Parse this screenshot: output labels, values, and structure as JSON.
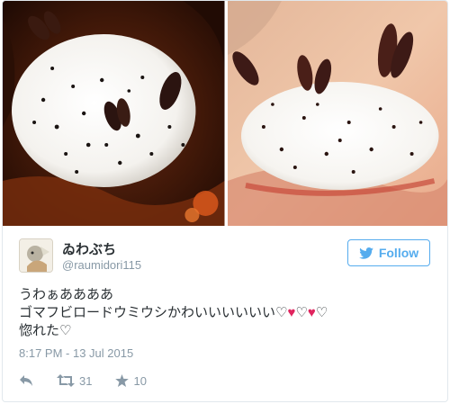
{
  "tweet": {
    "display_name": "ゐわぶち",
    "handle": "@raumidori115",
    "follow_label": "Follow",
    "text_lines": [
      "うわぁああああ",
      "ゴマフビロードウミウシかわいいいいいい",
      "惚れた♡"
    ],
    "hearts": [
      "♡",
      "♥",
      "♡",
      "♥",
      "♡"
    ],
    "timestamp": "8:17 PM - 13 Jul 2015",
    "retweet_count": "31",
    "favorite_count": "10"
  },
  "colors": {
    "accent": "#55acee",
    "heart_red": "#e0245e",
    "muted": "#8899a6",
    "text": "#292f33"
  },
  "icons": {
    "follow": "twitter-bird-icon",
    "reply": "reply-arrow-icon",
    "retweet": "retweet-icon",
    "favorite": "star-icon"
  }
}
